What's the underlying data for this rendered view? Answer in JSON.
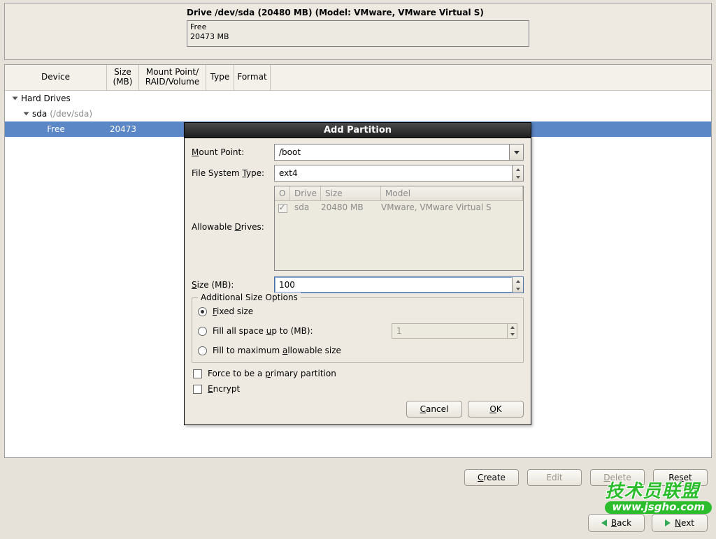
{
  "top": {
    "title": "Drive /dev/sda (20480 MB) (Model: VMware, VMware Virtual S)",
    "free_label": "Free",
    "free_size": "20473 MB"
  },
  "columns": {
    "device": "Device",
    "size": "Size\n(MB)",
    "mount": "Mount Point/\nRAID/Volume",
    "type": "Type",
    "format": "Format"
  },
  "tree": {
    "hard_drives": "Hard Drives",
    "sda_label": "sda",
    "sda_path": "(/dev/sda)",
    "free_label": "Free",
    "free_size": "20473"
  },
  "buttons": {
    "create": "Create",
    "edit": "Edit",
    "delete": "Delete",
    "reset": "Reset",
    "back": "Back",
    "next": "Next"
  },
  "dialog": {
    "title": "Add Partition",
    "mount_point_label": "Mount Point:",
    "mount_point_value": "/boot",
    "fs_type_label": "File System Type:",
    "fs_type_value": "ext4",
    "allowable_label": "Allowable Drives:",
    "drives_header": {
      "drive": "Drive",
      "size": "Size",
      "model": "Model"
    },
    "drive_row": {
      "name": "sda",
      "size": "20480 MB",
      "model": "VMware, VMware Virtual S"
    },
    "size_label": "Size (MB):",
    "size_value": "100",
    "aso_legend": "Additional Size Options",
    "opt_fixed": "Fixed size",
    "opt_fill_up": "Fill all space up to (MB):",
    "opt_fill_up_value": "1",
    "opt_fill_max": "Fill to maximum allowable size",
    "force_primary": "Force to be a primary partition",
    "encrypt": "Encrypt",
    "cancel": "Cancel",
    "ok": "OK"
  },
  "watermark": {
    "l1": "技术员联盟",
    "l2": "www.jsgho.com"
  }
}
